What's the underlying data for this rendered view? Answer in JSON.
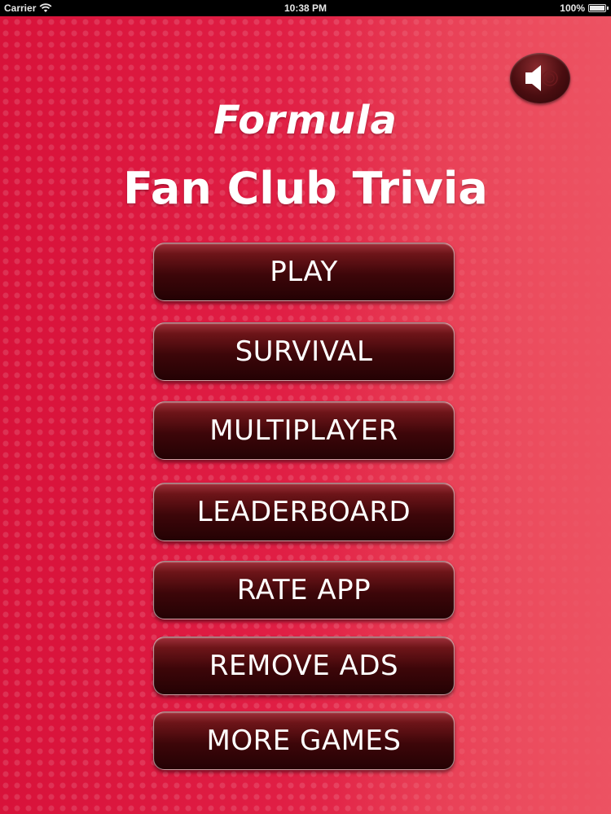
{
  "status_bar": {
    "carrier": "Carrier",
    "time": "10:38 PM",
    "battery": "100%"
  },
  "title": {
    "line1": "Formula",
    "line2": "Fan Club Trivia"
  },
  "menu": {
    "play": "PLAY",
    "survival": "SURVIVAL",
    "multiplayer": "MULTIPLAYER",
    "leaderboard": "LEADERBOARD",
    "rate_app": "RATE APP",
    "remove_ads": "REMOVE ADS",
    "more_games": "MORE GAMES"
  },
  "icons": {
    "sound": "speaker-icon",
    "wifi": "wifi-icon",
    "battery": "battery-icon"
  },
  "colors": {
    "background": "#d8123a",
    "button": "#3d0609",
    "text": "#ffffff"
  }
}
